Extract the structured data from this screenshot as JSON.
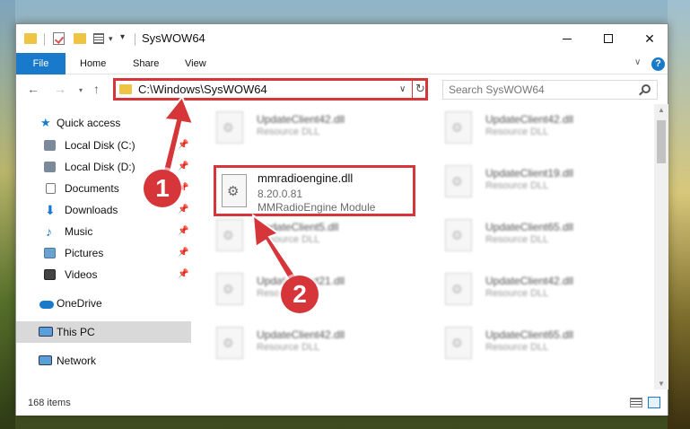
{
  "window": {
    "title": "SysWOW64"
  },
  "ribbon": {
    "tabs": [
      "File",
      "Home",
      "Share",
      "View"
    ]
  },
  "address": {
    "path": "C:\\Windows\\SysWOW64"
  },
  "search": {
    "placeholder": "Search SysWOW64"
  },
  "nav_pane": {
    "quick_access": "Quick access",
    "items": [
      {
        "label": "Local Disk (C:)",
        "pinned": true
      },
      {
        "label": "Local Disk (D:)",
        "pinned": true
      },
      {
        "label": "Documents",
        "pinned": true
      },
      {
        "label": "Downloads",
        "pinned": true
      },
      {
        "label": "Music",
        "pinned": true
      },
      {
        "label": "Pictures",
        "pinned": true
      },
      {
        "label": "Videos",
        "pinned": true
      }
    ],
    "onedrive": "OneDrive",
    "this_pc": "This PC",
    "network": "Network"
  },
  "files": {
    "left": [
      {
        "name": "UpdateClient42.dll",
        "desc": "Resource DLL"
      },
      {
        "name": "UpdateClient5.dll",
        "desc": "Resource DLL"
      },
      {
        "name": "UpdateClient21.dll",
        "desc": "Resource DLL"
      },
      {
        "name": "UpdateClient42.dll",
        "desc": "Resource DLL"
      }
    ],
    "right": [
      {
        "name": "UpdateClient42.dll",
        "desc": "Resource DLL"
      },
      {
        "name": "UpdateClient19.dll",
        "desc": "Resource DLL"
      },
      {
        "name": "UpdateClient65.dll",
        "desc": "Resource DLL"
      },
      {
        "name": "UpdateClient42.dll",
        "desc": "Resource DLL"
      },
      {
        "name": "UpdateClient65.dll",
        "desc": "Resource DLL"
      }
    ],
    "highlighted": {
      "name": "mmradioengine.dll",
      "version": "8.20.0.81",
      "desc": "MMRadioEngine Module"
    }
  },
  "status": {
    "items": "168 items"
  },
  "callouts": [
    "1",
    "2"
  ],
  "colors": {
    "accent": "#1979ca",
    "annotation": "#d6353a",
    "folder": "#f0c443"
  }
}
